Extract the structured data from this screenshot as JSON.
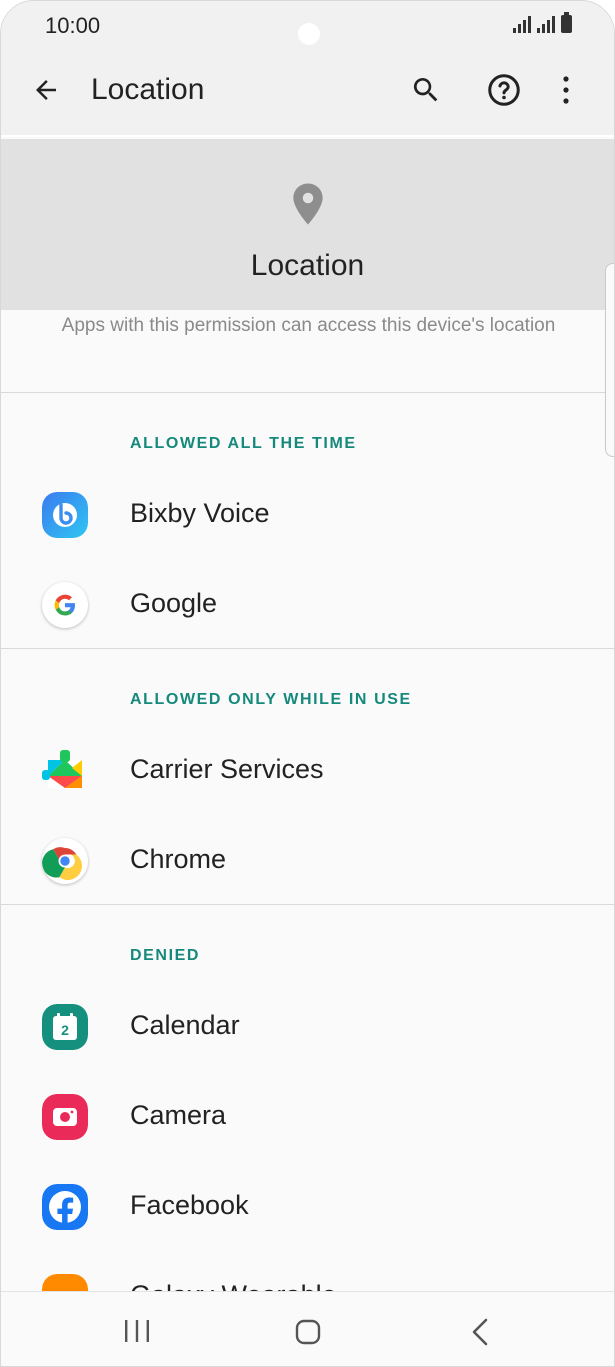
{
  "status_bar": {
    "time": "10:00"
  },
  "app_bar": {
    "title": "Location",
    "back_icon": "arrow-left-icon",
    "search_icon": "search-icon",
    "help_icon": "help-circle-icon",
    "more_icon": "more-vertical-icon"
  },
  "header": {
    "icon": "location-pin-icon",
    "title": "Location",
    "description": "Apps with this permission can access this device's location"
  },
  "sections": {
    "allowed_all_time": {
      "title": "ALLOWED ALL THE TIME",
      "items": [
        {
          "label": "Bixby Voice",
          "icon": "bixby-voice-icon"
        },
        {
          "label": "Google",
          "icon": "google-icon"
        }
      ]
    },
    "allowed_while_in_use": {
      "title": "ALLOWED ONLY WHILE IN USE",
      "items": [
        {
          "label": "Carrier Services",
          "icon": "carrier-services-icon"
        },
        {
          "label": "Chrome",
          "icon": "chrome-icon"
        }
      ]
    },
    "denied": {
      "title": "DENIED",
      "items": [
        {
          "label": "Calendar",
          "icon": "calendar-icon",
          "badge": "2"
        },
        {
          "label": "Camera",
          "icon": "camera-icon"
        },
        {
          "label": "Facebook",
          "icon": "facebook-icon"
        },
        {
          "label": "Galaxy Wearable",
          "icon": "galaxy-wearable-icon"
        }
      ]
    }
  },
  "colors": {
    "accent": "#15897b",
    "header_band": "#e1e1e1",
    "background": "#fafafa"
  },
  "nav_bar": {
    "recent_icon": "recent-apps-icon",
    "home_icon": "home-icon",
    "back_icon": "back-chevron-icon"
  }
}
